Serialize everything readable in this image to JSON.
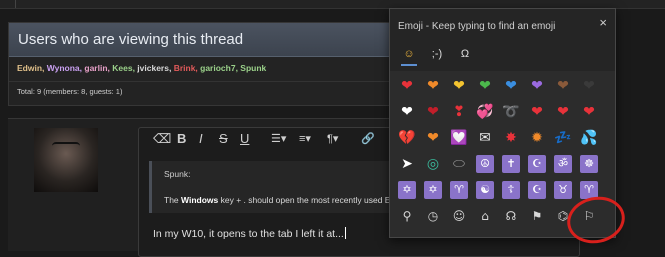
{
  "viewers": {
    "title": "Users who are viewing this thread",
    "names": [
      {
        "name": "Edwin,",
        "color": "#e0c08a"
      },
      {
        "name": "Wynona,",
        "color": "#c9a0f0"
      },
      {
        "name": "garlin,",
        "color": "#e7a0c8"
      },
      {
        "name": "Kees,",
        "color": "#9bd18a"
      },
      {
        "name": "jvickers,",
        "color": "#d8d8d8"
      },
      {
        "name": "Brink,",
        "color": "#e15a5a"
      },
      {
        "name": "garioch7,",
        "color": "#9bd18a"
      },
      {
        "name": "Spunk",
        "color": "#9bd18a"
      }
    ],
    "total": "Total: 9 (members: 8, guests: 1)"
  },
  "editor": {
    "toolbar": {
      "eraser": "⌫",
      "bold": "B",
      "italic": "I",
      "strike": "S",
      "underline": "U",
      "list": "☰▾",
      "align": "≡▾",
      "para": "¶▾",
      "link": "🔗"
    },
    "quote": {
      "author": "Spunk:",
      "text_pre": "The ",
      "text_bold": "Windows",
      "text_post": " key + . should open the most recently used Em"
    },
    "typed": "In my W10, it opens to the tab I left it at..."
  },
  "emoji_panel": {
    "title": "Emoji - Keep typing to find an emoji",
    "close": "×",
    "tabs": [
      "☺",
      ";-)",
      "Ω"
    ],
    "rows": [
      [
        {
          "g": "❤",
          "c": "#e8323a"
        },
        {
          "g": "❤",
          "c": "#f08a2a"
        },
        {
          "g": "❤",
          "c": "#f4c430"
        },
        {
          "g": "❤",
          "c": "#4cb84c"
        },
        {
          "g": "❤",
          "c": "#3a8ee0"
        },
        {
          "g": "❤",
          "c": "#9a6ae0"
        },
        {
          "g": "❤",
          "c": "#8a5a3a"
        },
        {
          "g": "❤",
          "c": "#3a3a3a"
        }
      ],
      [
        {
          "g": "❤",
          "c": "#ffffff"
        },
        {
          "g": "❤",
          "c": "#c21e2a"
        },
        {
          "g": "❣",
          "c": "#e8323a"
        },
        {
          "g": "💞",
          "c": "#e8323a"
        },
        {
          "g": "➰",
          "c": "#e8323a"
        },
        {
          "g": "❤",
          "c": "#e8323a"
        },
        {
          "g": "❤",
          "c": "#e8323a"
        },
        {
          "g": "❤",
          "c": "#e8323a"
        }
      ],
      [
        {
          "g": "💔",
          "c": "#e8323a"
        },
        {
          "g": "❤",
          "c": "#f08a2a"
        },
        {
          "g": "💟",
          "c": "#e8323a"
        },
        {
          "g": "✉",
          "c": "#e8e8e8"
        },
        {
          "g": "✸",
          "c": "#e8323a"
        },
        {
          "g": "✹",
          "c": "#f08a2a"
        },
        {
          "g": "💤",
          "c": "#5aa8e8"
        },
        {
          "g": "💦",
          "c": "#5ab8f0"
        }
      ],
      [
        {
          "g": "➤",
          "c": "#ffffff"
        },
        {
          "g": "◎",
          "c": "#3abfa0"
        },
        {
          "g": "⬭",
          "c": "#9a9a9a"
        },
        {
          "g": "☮",
          "sym": true
        },
        {
          "g": "✝",
          "sym": true
        },
        {
          "g": "☪",
          "sym": true
        },
        {
          "g": "ॐ",
          "sym": true
        },
        {
          "g": "☸",
          "sym": true
        }
      ],
      [
        {
          "g": "✡",
          "sym": true
        },
        {
          "g": "✡",
          "sym": true
        },
        {
          "g": "♈",
          "sym": true
        },
        {
          "g": "☯",
          "sym": true
        },
        {
          "g": "☦",
          "sym": true
        },
        {
          "g": "☪",
          "sym": true
        },
        {
          "g": "♉",
          "sym": true
        },
        {
          "g": "♈",
          "sym": true
        }
      ],
      [
        {
          "g": "⚲",
          "gray": true
        },
        {
          "g": "◷",
          "gray": true
        },
        {
          "g": "☺",
          "gray": true
        },
        {
          "g": "⌂",
          "gray": true
        },
        {
          "g": "☊",
          "gray": true
        },
        {
          "g": "⚑",
          "gray": true
        },
        {
          "g": "⌬",
          "gray": true
        },
        {
          "g": "⚐",
          "gray": true
        }
      ]
    ]
  }
}
